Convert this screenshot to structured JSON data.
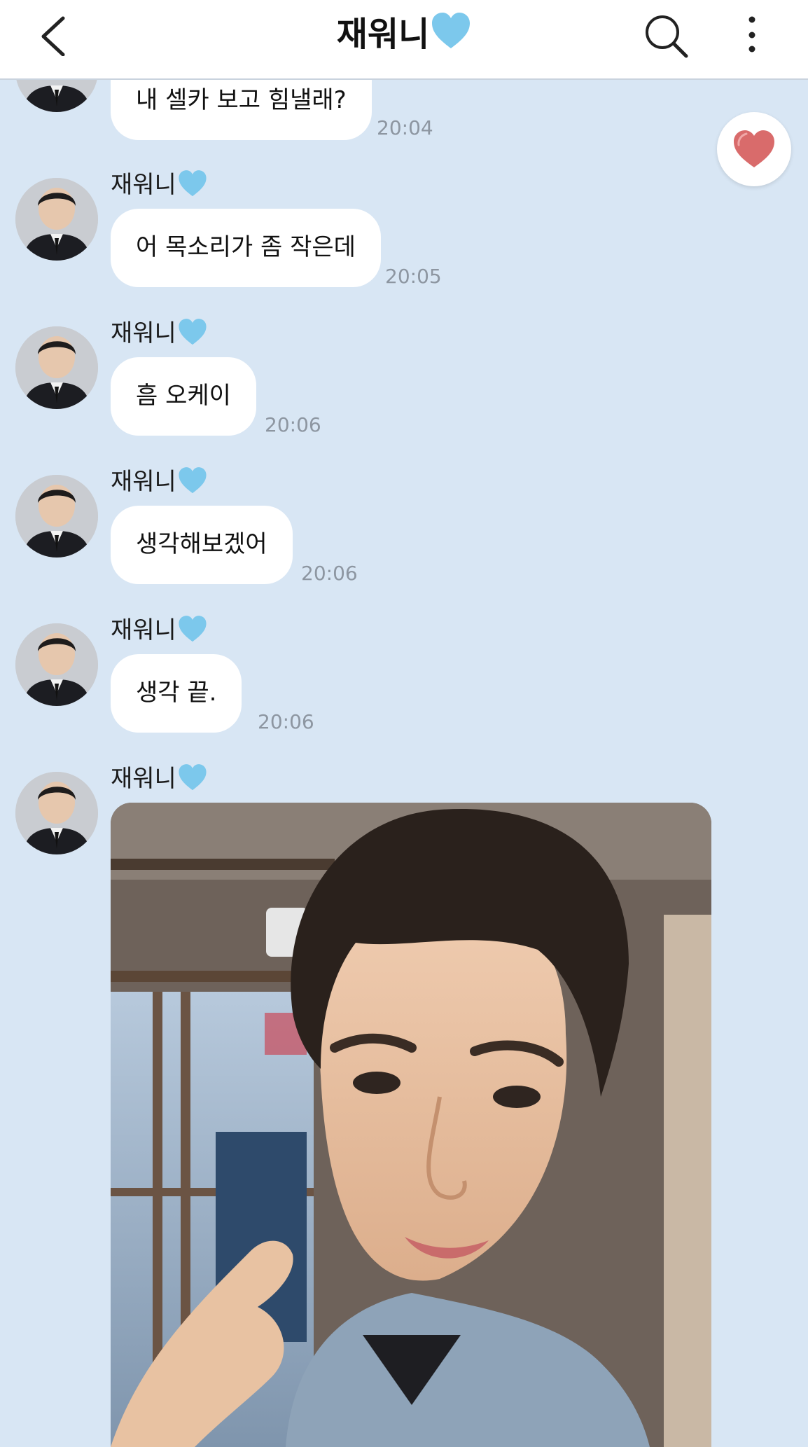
{
  "header": {
    "title": "재워니",
    "title_emoji": "light-blue-heart-icon"
  },
  "messages": [
    {
      "sender": "",
      "text": "내 셀카 보고 힘낼래?",
      "time": "20:04"
    },
    {
      "sender": "재워니",
      "text": "어 목소리가 좀 작은데",
      "time": "20:05"
    },
    {
      "sender": "재워니",
      "text": "흠 오케이",
      "time": "20:06"
    },
    {
      "sender": "재워니",
      "text": "생각해보겠어",
      "time": "20:06"
    },
    {
      "sender": "재워니",
      "text": "생각 끝.",
      "time": "20:06"
    },
    {
      "sender": "재워니",
      "text": "",
      "time": ""
    }
  ],
  "colors": {
    "background": "#d8e6f4",
    "bubble": "#ffffff",
    "timestamp": "#8d96a1",
    "heart_blue": "#7cc8ec",
    "fab_heart": "#d96b6b"
  }
}
